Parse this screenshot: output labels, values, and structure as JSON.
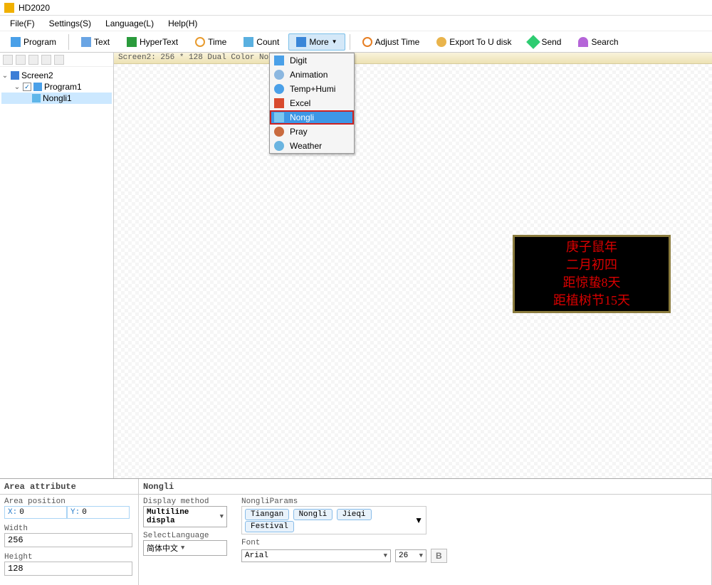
{
  "app": {
    "title": "HD2020"
  },
  "menu": {
    "file": "File(F)",
    "settings": "Settings(S)",
    "language": "Language(L)",
    "help": "Help(H)"
  },
  "toolbar": {
    "program": "Program",
    "text": "Text",
    "hypertext": "HyperText",
    "time": "Time",
    "count": "Count",
    "more": "More",
    "adjust_time": "Adjust Time",
    "export": "Export To U disk",
    "send": "Send",
    "search": "Search"
  },
  "tree": {
    "screen2": "Screen2",
    "program1": "Program1",
    "nongli1": "Nongli1"
  },
  "canvas_header": "Screen2: 256 * 128 Dual Color No grayleve",
  "more_dropdown": {
    "digit": "Digit",
    "animation": "Animation",
    "temphumi": "Temp+Humi",
    "excel": "Excel",
    "nongli": "Nongli",
    "pray": "Pray",
    "weather": "Weather"
  },
  "preview": {
    "line1": "庚子鼠年",
    "line2": "二月初四",
    "line3": "距惊蛰8天",
    "line4": "距植树节15天"
  },
  "area_panel": {
    "title": "Area attribute",
    "pos_label": "Area position",
    "x_label": "X:",
    "x_value": "0",
    "y_label": "Y:",
    "y_value": "0",
    "width_label": "Width",
    "width_value": "256",
    "height_label": "Height",
    "height_value": "128"
  },
  "nongli_panel": {
    "title": "Nongli",
    "display_method_label": "Display method",
    "display_method_value": "Multiline displa",
    "select_language_label": "SelectLanguage",
    "select_language_value": "简体中文",
    "params_label": "NongliParams",
    "params": [
      "Tiangan",
      "Nongli",
      "Jieqi",
      "Festival"
    ],
    "font_label": "Font",
    "font_name": "Arial",
    "font_size": "26",
    "bold_label": "B"
  }
}
